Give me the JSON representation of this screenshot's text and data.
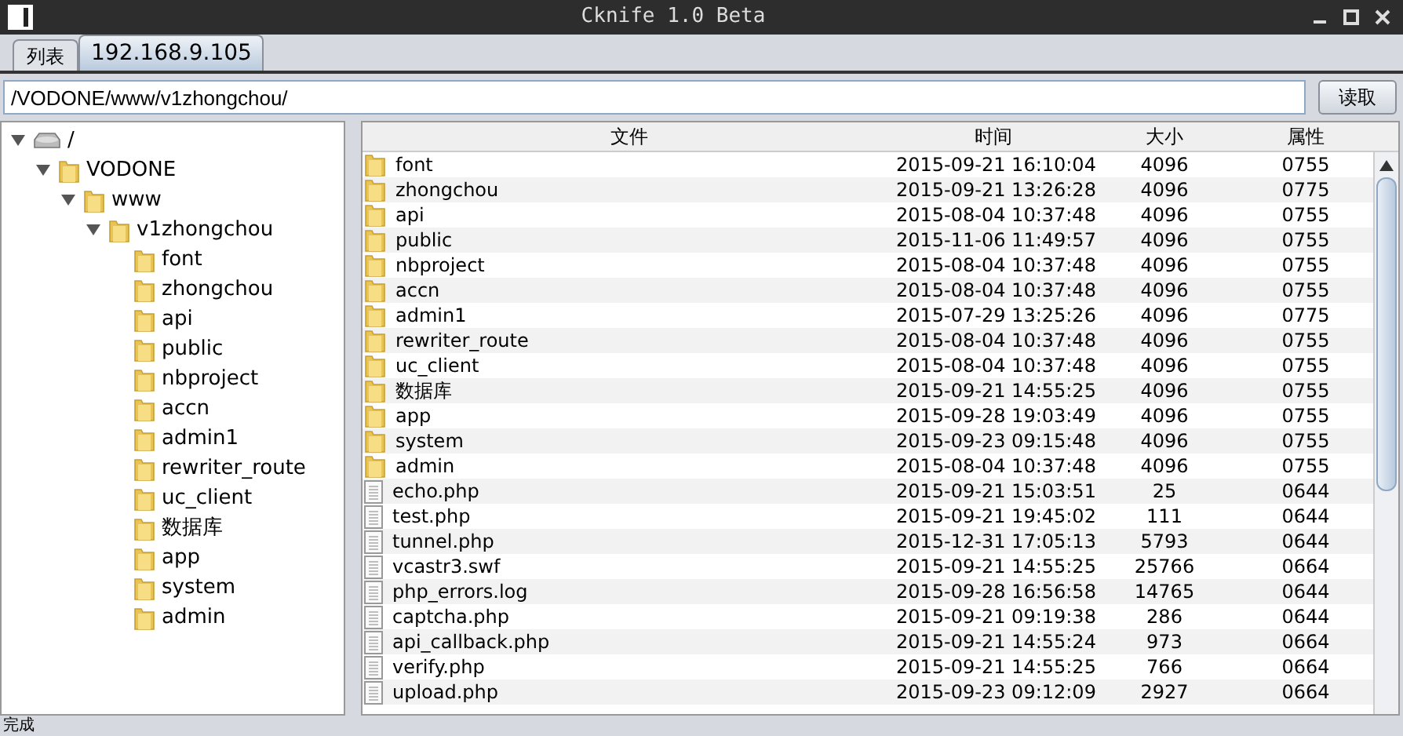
{
  "window": {
    "title": "Cknife 1.0 Beta"
  },
  "tabs": [
    {
      "label": "列表",
      "selected": false
    },
    {
      "label": "192.168.9.105",
      "selected": true
    }
  ],
  "path_field": {
    "value": "/VODONE/www/v1zhongchou/"
  },
  "read_button": "读取",
  "tree": [
    {
      "label": "/",
      "kind": "drive",
      "expanded": true,
      "children": [
        {
          "label": "VODONE",
          "kind": "folder",
          "expanded": true,
          "children": [
            {
              "label": "www",
              "kind": "folder",
              "expanded": true,
              "children": [
                {
                  "label": "v1zhongchou",
                  "kind": "folder",
                  "expanded": true,
                  "children": [
                    {
                      "label": "font",
                      "kind": "folder"
                    },
                    {
                      "label": "zhongchou",
                      "kind": "folder"
                    },
                    {
                      "label": "api",
                      "kind": "folder"
                    },
                    {
                      "label": "public",
                      "kind": "folder"
                    },
                    {
                      "label": "nbproject",
                      "kind": "folder"
                    },
                    {
                      "label": "accn",
                      "kind": "folder"
                    },
                    {
                      "label": "admin1",
                      "kind": "folder"
                    },
                    {
                      "label": "rewriter_route",
                      "kind": "folder"
                    },
                    {
                      "label": "uc_client",
                      "kind": "folder"
                    },
                    {
                      "label": "数据库",
                      "kind": "folder"
                    },
                    {
                      "label": "app",
                      "kind": "folder"
                    },
                    {
                      "label": "system",
                      "kind": "folder"
                    },
                    {
                      "label": "admin",
                      "kind": "folder"
                    }
                  ]
                }
              ]
            }
          ]
        }
      ]
    }
  ],
  "table": {
    "columns": [
      "文件",
      "时间",
      "大小",
      "属性"
    ],
    "rows": [
      {
        "kind": "folder",
        "name": "font",
        "time": "2015-09-21 16:10:04",
        "size": "4096",
        "attr": "0755"
      },
      {
        "kind": "folder",
        "name": "zhongchou",
        "time": "2015-09-21 13:26:28",
        "size": "4096",
        "attr": "0775"
      },
      {
        "kind": "folder",
        "name": "api",
        "time": "2015-08-04 10:37:48",
        "size": "4096",
        "attr": "0755"
      },
      {
        "kind": "folder",
        "name": "public",
        "time": "2015-11-06 11:49:57",
        "size": "4096",
        "attr": "0755"
      },
      {
        "kind": "folder",
        "name": "nbproject",
        "time": "2015-08-04 10:37:48",
        "size": "4096",
        "attr": "0755"
      },
      {
        "kind": "folder",
        "name": "accn",
        "time": "2015-08-04 10:37:48",
        "size": "4096",
        "attr": "0755"
      },
      {
        "kind": "folder",
        "name": "admin1",
        "time": "2015-07-29 13:25:26",
        "size": "4096",
        "attr": "0775"
      },
      {
        "kind": "folder",
        "name": "rewriter_route",
        "time": "2015-08-04 10:37:48",
        "size": "4096",
        "attr": "0755"
      },
      {
        "kind": "folder",
        "name": "uc_client",
        "time": "2015-08-04 10:37:48",
        "size": "4096",
        "attr": "0755"
      },
      {
        "kind": "folder",
        "name": "数据库",
        "time": "2015-09-21 14:55:25",
        "size": "4096",
        "attr": "0755"
      },
      {
        "kind": "folder",
        "name": "app",
        "time": "2015-09-28 19:03:49",
        "size": "4096",
        "attr": "0755"
      },
      {
        "kind": "folder",
        "name": "system",
        "time": "2015-09-23 09:15:48",
        "size": "4096",
        "attr": "0755"
      },
      {
        "kind": "folder",
        "name": "admin",
        "time": "2015-08-04 10:37:48",
        "size": "4096",
        "attr": "0755"
      },
      {
        "kind": "file",
        "name": "echo.php",
        "time": "2015-09-21 15:03:51",
        "size": "25",
        "attr": "0644"
      },
      {
        "kind": "file",
        "name": "test.php",
        "time": "2015-09-21 19:45:02",
        "size": "111",
        "attr": "0644"
      },
      {
        "kind": "file",
        "name": "tunnel.php",
        "time": "2015-12-31 17:05:13",
        "size": "5793",
        "attr": "0644"
      },
      {
        "kind": "file",
        "name": "vcastr3.swf",
        "time": "2015-09-21 14:55:25",
        "size": "25766",
        "attr": "0664"
      },
      {
        "kind": "file",
        "name": "php_errors.log",
        "time": "2015-09-28 16:56:58",
        "size": "14765",
        "attr": "0644"
      },
      {
        "kind": "file",
        "name": "captcha.php",
        "time": "2015-09-21 09:19:38",
        "size": "286",
        "attr": "0644"
      },
      {
        "kind": "file",
        "name": "api_callback.php",
        "time": "2015-09-21 14:55:24",
        "size": "973",
        "attr": "0664"
      },
      {
        "kind": "file",
        "name": "verify.php",
        "time": "2015-09-21 14:55:25",
        "size": "766",
        "attr": "0664"
      },
      {
        "kind": "file",
        "name": "upload.php",
        "time": "2015-09-23 09:12:09",
        "size": "2927",
        "attr": "0664"
      }
    ]
  },
  "status_bar": "完成"
}
